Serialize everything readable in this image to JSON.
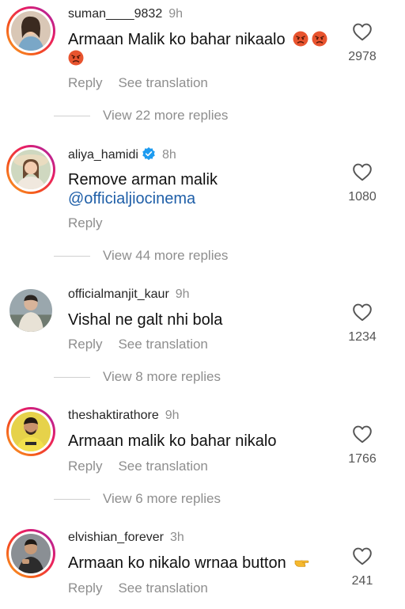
{
  "comments": [
    {
      "username": "suman____9832",
      "time": "9h",
      "text": "Armaan Malik ko bahar nikaalo",
      "likes": "2978",
      "reply_label": "Reply",
      "translate_label": "See translation",
      "view_replies": "View 22 more replies",
      "avatar_ring": true,
      "emoji": "angry-face"
    },
    {
      "username": "aliya_hamidi",
      "verified": true,
      "time": "8h",
      "text": "Remove arman malik",
      "mention": "@officialjiocinema",
      "likes": "1080",
      "reply_label": "Reply",
      "view_replies": "View 44 more replies",
      "avatar_ring": true
    },
    {
      "username": "officialmanjit_kaur",
      "time": "9h",
      "text": "Vishal ne galt nhi bola",
      "likes": "1234",
      "reply_label": "Reply",
      "translate_label": "See translation",
      "view_replies": "View 8 more replies",
      "avatar_ring": false
    },
    {
      "username": "theshaktirathore",
      "time": "9h",
      "text": "Armaan malik ko bahar nikalo",
      "likes": "1766",
      "reply_label": "Reply",
      "translate_label": "See translation",
      "view_replies": "View 6 more replies",
      "avatar_ring": true
    },
    {
      "username": "elvishian_forever",
      "time": "3h",
      "text": "Armaan ko nikalo wrnaa button",
      "likes": "241",
      "reply_label": "Reply",
      "translate_label": "See translation",
      "avatar_ring": true,
      "emoji": "pointing-hand"
    }
  ],
  "colors": {
    "mention": "#1f5fa8",
    "verified_badge": "#1d9bf0",
    "secondary_text": "#8e8e8e"
  }
}
